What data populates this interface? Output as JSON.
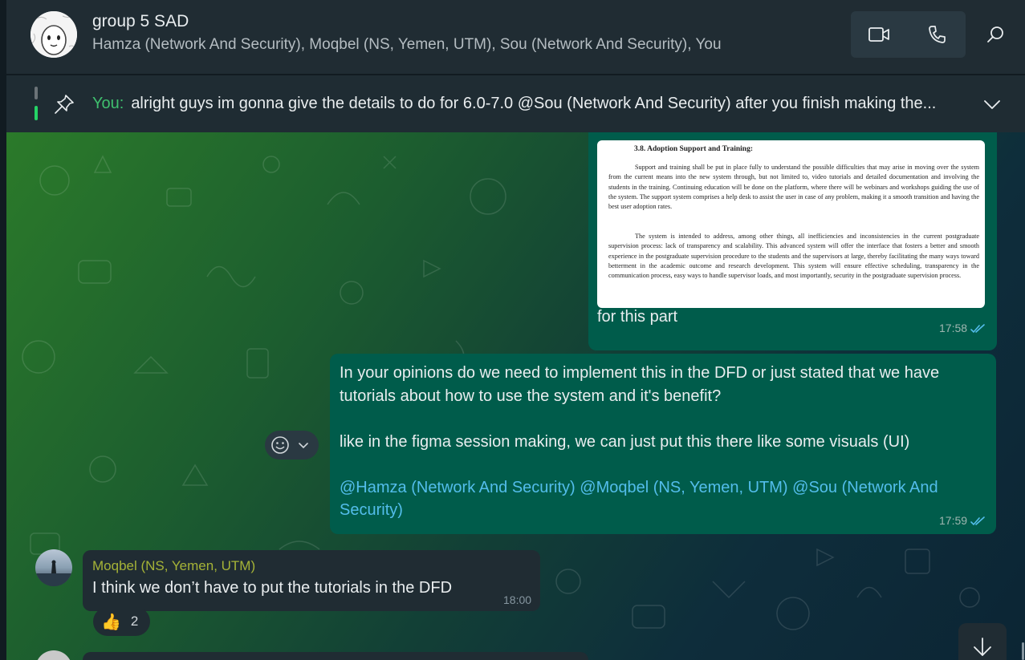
{
  "header": {
    "title": "group 5 SAD",
    "members": "Hamza (Network And Security), Moqbel (NS, Yemen, UTM), Sou (Network And Security), You",
    "icons": [
      "group-avatar",
      "video-call-icon",
      "voice-call-icon",
      "search-icon"
    ]
  },
  "pinned": {
    "sender": "You:",
    "text": "alright guys im gonna give the details to do for 6.0-7.0  @Sou (Network And Security) after you finish making the...",
    "icons": [
      "pin-icon",
      "chevron-down-icon"
    ]
  },
  "messages": {
    "m1": {
      "doc_heading": "3.8. Adoption Support and Training:",
      "doc_para1": "Support and training shall be put in place fully to understand the possible difficulties that may arise in moving over the system from the current means into the new system through, but not limited to, video tutorials and detailed documentation and involving the students in the training. Continuing education will be done on the platform, where there will be webinars and workshops guiding the use of the system. The support system comprises a help desk to assist the user in case of any problem, making it a smooth transition and having the best user adoption rates.",
      "doc_para2": "The system is intended to address, among other things, all inefficiencies and inconsistencies in the current postgraduate supervision process: lack of transparency and scalability. This advanced system will offer the interface that fosters a better and smooth experience in the postgraduate supervision procedure to the students and the supervisors at large, thereby facilitating the many ways toward betterment in the academic outcome and research development. This system will ensure effective scheduling, transparency in the communication process, easy ways to handle supervisor loads, and most importantly, security in the postgraduate supervision process.",
      "caption": "for this part",
      "time": "17:58"
    },
    "m2": {
      "line1": "In your opinions do we need to implement this in the DFD or just stated that we have tutorials about how to use the system and it's benefit?",
      "line2": "like in the figma session making, we can just put this there like some visuals (UI)",
      "mention1": "@Hamza (Network And Security)",
      "mention2": "@Moqbel (NS, Yemen, UTM)",
      "mention3": "@Sou (Network And Security)",
      "time": "17:59"
    },
    "m3": {
      "sender": "Moqbel (NS, Yemen, UTM)",
      "text": "I think we don’t have to put the tutorials in the DFD",
      "time": "18:00",
      "reaction_emoji": "👍",
      "reaction_count": "2"
    }
  },
  "colors": {
    "outgoing_bubble": "#005c4b",
    "incoming_bubble": "#202c33",
    "mention": "#53bdeb",
    "sender_name": "#a5b337",
    "pinned_sender": "#3fbf6e",
    "read_ticks": "#53bdeb"
  }
}
